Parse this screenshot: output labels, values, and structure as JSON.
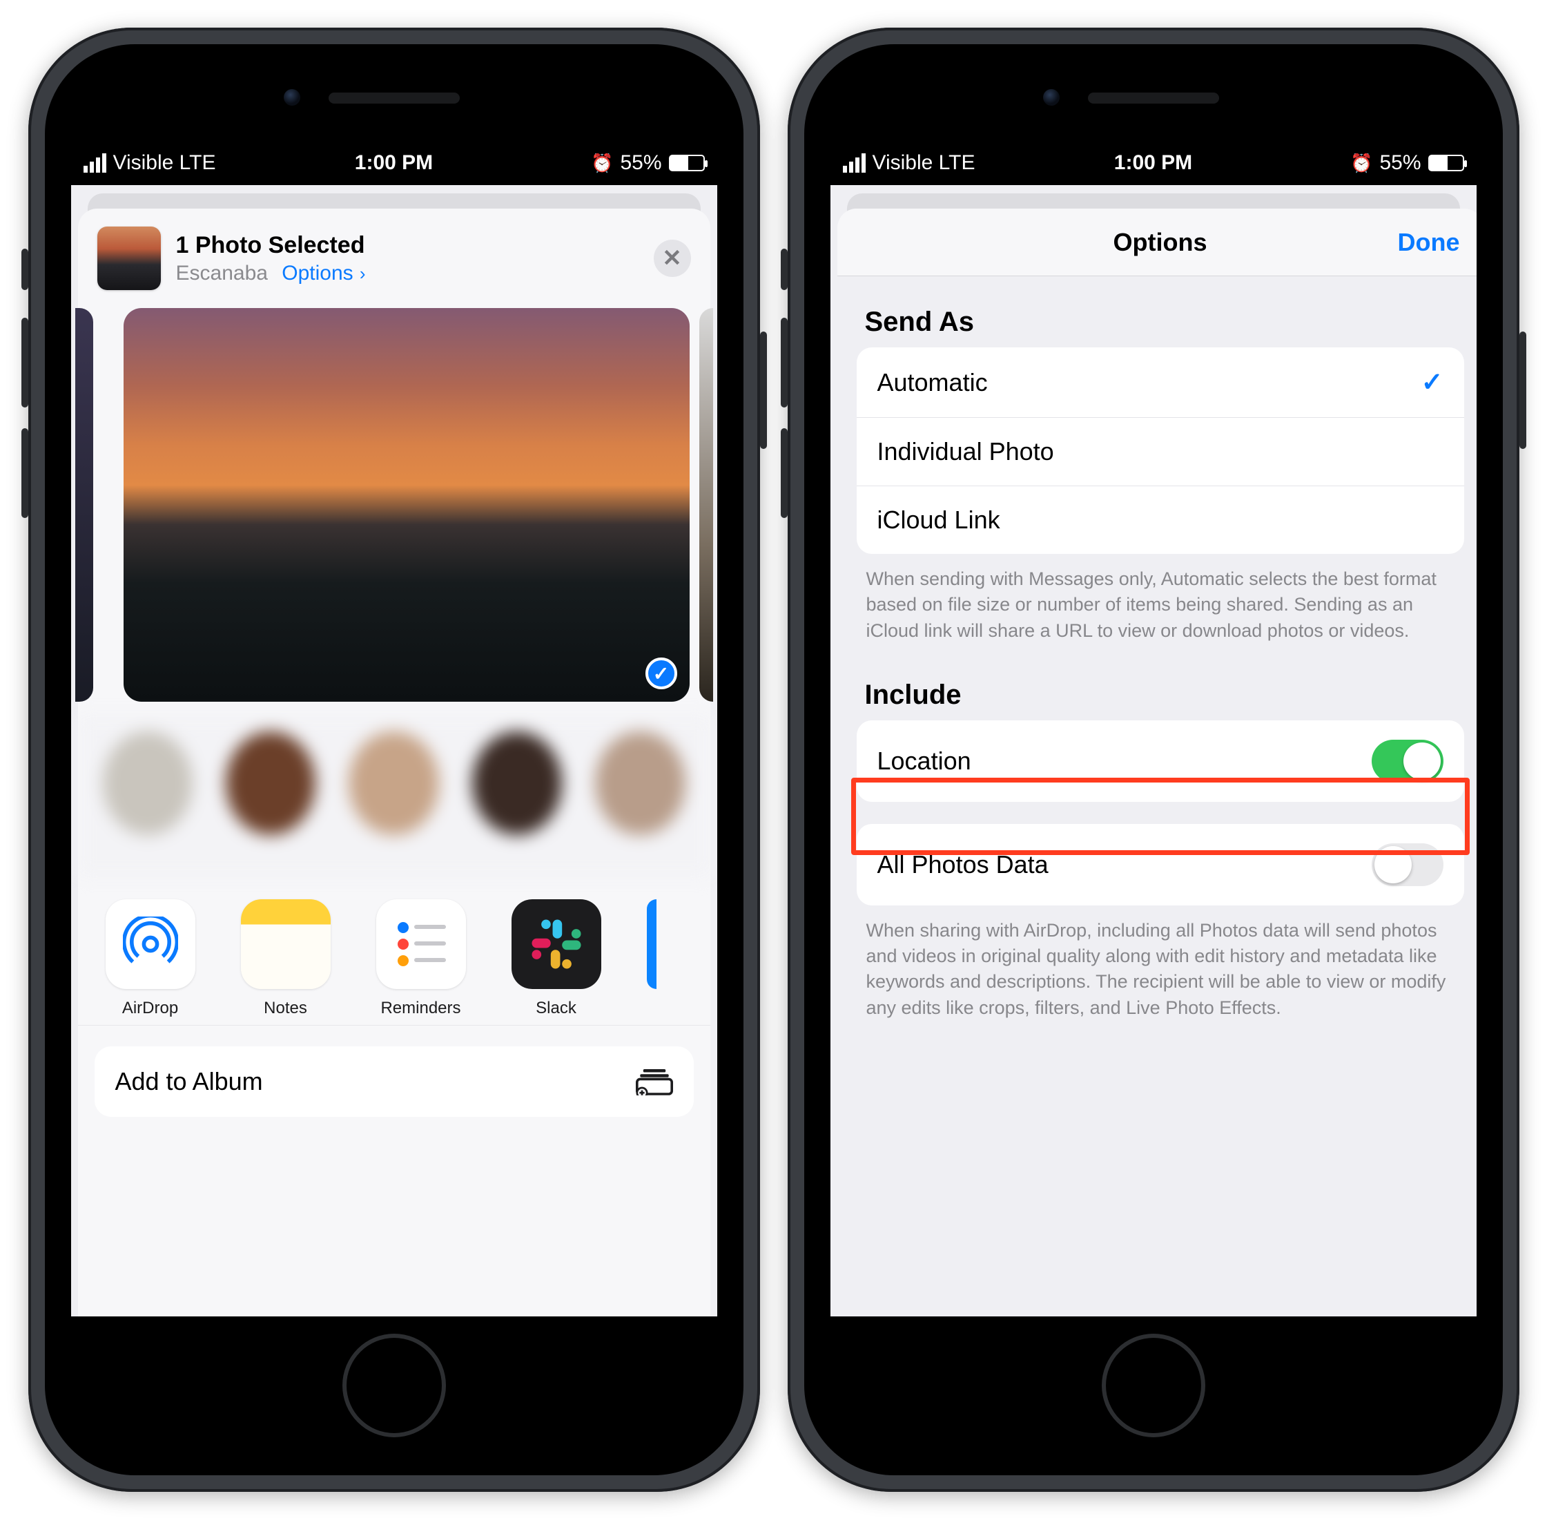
{
  "status": {
    "carrier": "Visible LTE",
    "time": "1:00 PM",
    "battery_pct": "55%"
  },
  "share_sheet": {
    "title": "1 Photo Selected",
    "location": "Escanaba",
    "options_link": "Options",
    "apps": {
      "airdrop": "AirDrop",
      "notes": "Notes",
      "reminders": "Reminders",
      "slack": "Slack"
    },
    "action_add_to_album": "Add to Album"
  },
  "options_screen": {
    "nav_title": "Options",
    "done": "Done",
    "send_as_header": "Send As",
    "send_as": {
      "automatic": "Automatic",
      "individual": "Individual Photo",
      "icloud": "iCloud Link"
    },
    "send_as_footer": "When sending with Messages only, Automatic selects the best format based on file size or number of items being shared. Sending as an iCloud link will share a URL to view or download photos or videos.",
    "include_header": "Include",
    "include": {
      "location": "Location",
      "all_photos_data": "All Photos Data"
    },
    "include_footer": "When sharing with AirDrop, including all Photos data will send photos and videos in original quality along with edit history and metadata like keywords and descriptions. The recipient will be able to view or modify any edits like crops, filters, and Live Photo Effects."
  }
}
